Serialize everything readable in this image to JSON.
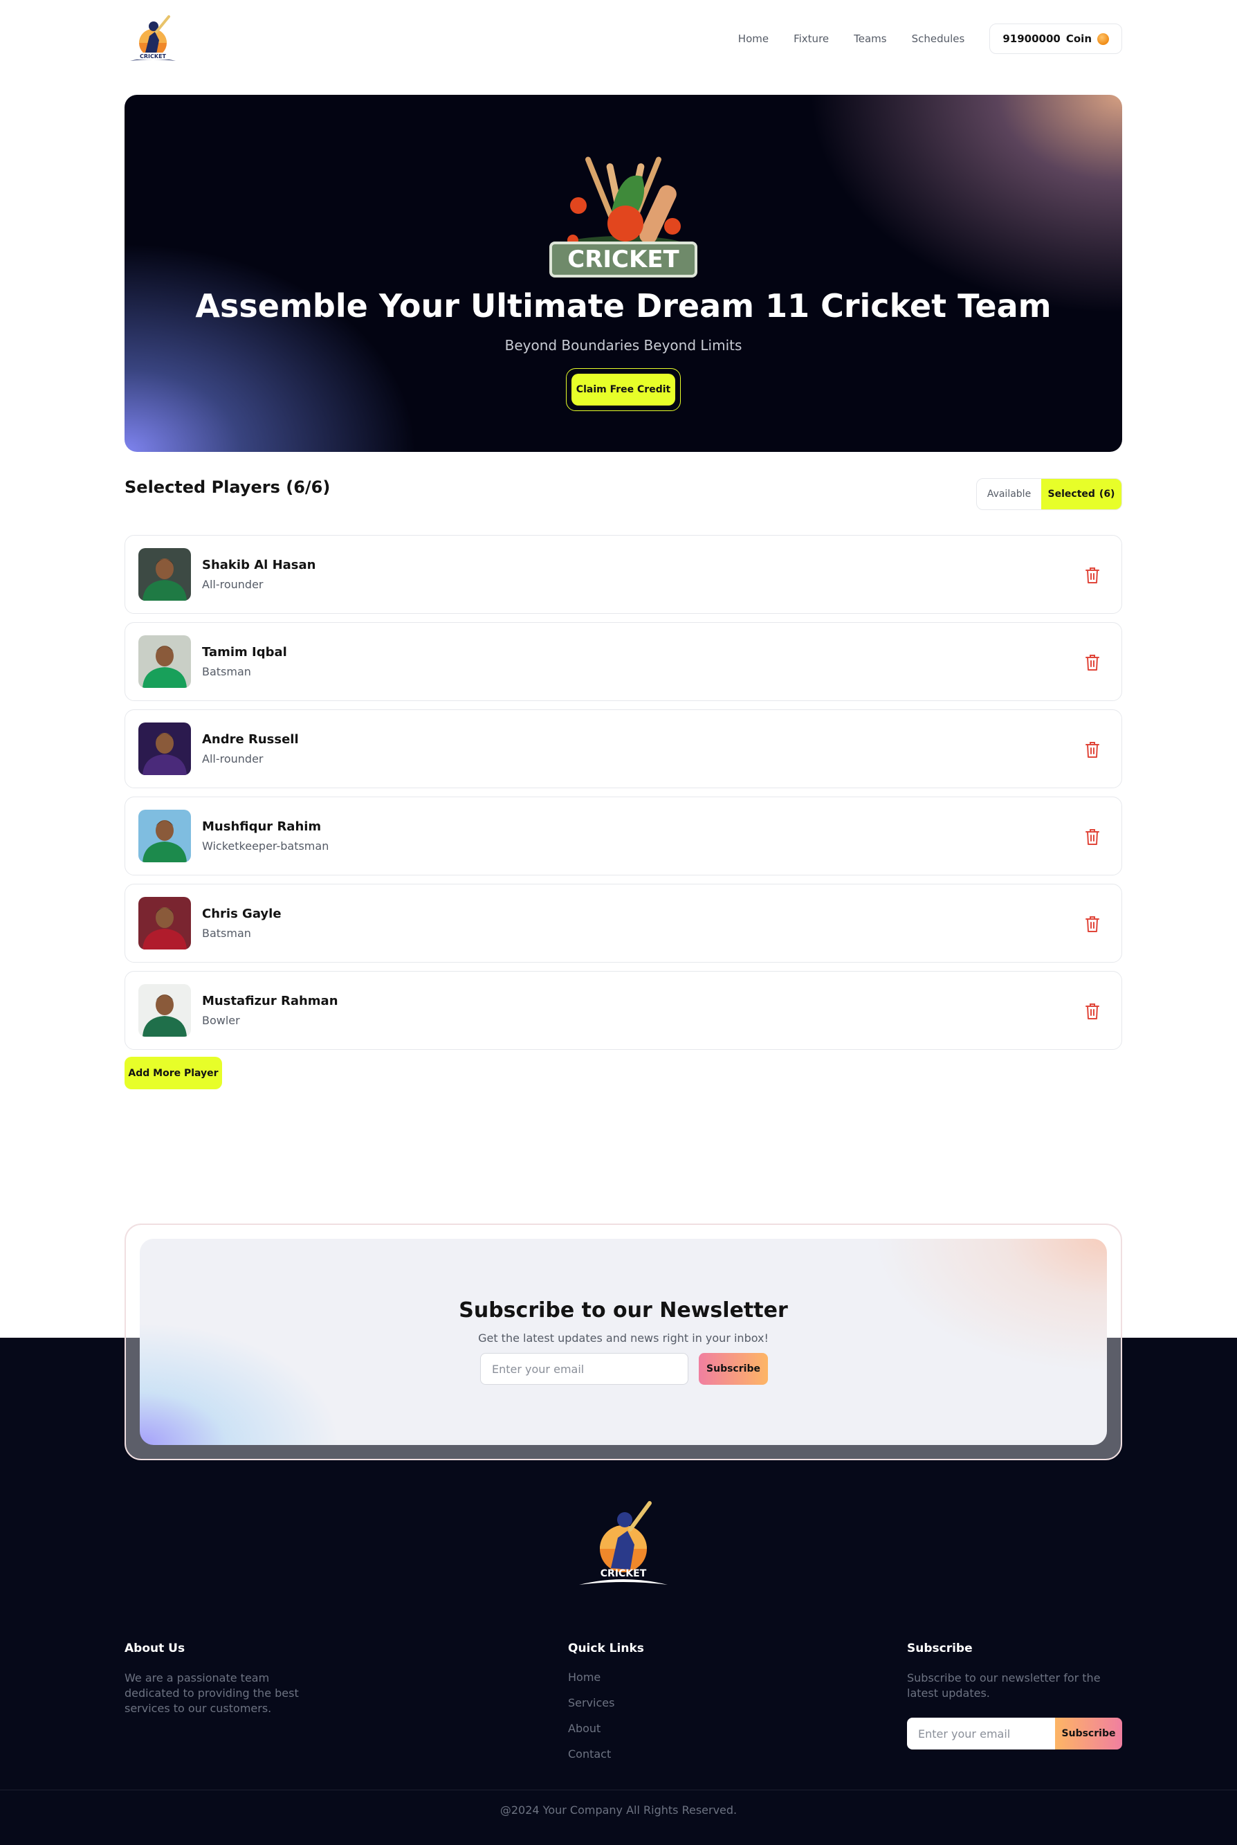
{
  "nav": {
    "links": [
      "Home",
      "Fixture",
      "Teams",
      "Schedules"
    ],
    "coin_amount": "91900000",
    "coin_label": "Coin",
    "logo_text": "CRICKET"
  },
  "hero": {
    "logo_text": "CRICKET",
    "title": "Assemble Your Ultimate Dream 11 Cricket Team",
    "subtitle": "Beyond Boundaries Beyond Limits",
    "cta": "Claim Free Credit"
  },
  "selected": {
    "title": "Selected Players (6/6)",
    "toggle_available": "Available",
    "toggle_selected": "Selected",
    "toggle_selected_count": "(6)",
    "players": [
      {
        "name": "Shakib Al Hasan",
        "role": "All-rounder",
        "jersey": "#1f7a44",
        "bg": "#3d4a44"
      },
      {
        "name": "Tamim Iqbal",
        "role": "Batsman",
        "jersey": "#18a05a",
        "bg": "#c9cfc6"
      },
      {
        "name": "Andre Russell",
        "role": "All-rounder",
        "jersey": "#4a2a7a",
        "bg": "#2b1a4e"
      },
      {
        "name": "Mushfiqur Rahim",
        "role": "Wicketkeeper-batsman",
        "jersey": "#1c8a4c",
        "bg": "#7fbde0"
      },
      {
        "name": "Chris Gayle",
        "role": "Batsman",
        "jersey": "#b01c2c",
        "bg": "#7a2530"
      },
      {
        "name": "Mustafizur Rahman",
        "role": "Bowler",
        "jersey": "#1f6f4a",
        "bg": "#eef0ee"
      }
    ],
    "add_button": "Add More Player"
  },
  "newsletter": {
    "title": "Subscribe to our Newsletter",
    "subtitle": "Get the latest updates and news right in your inbox!",
    "placeholder": "Enter your email",
    "button": "Subscribe"
  },
  "footer": {
    "logo_text": "CRICKET",
    "about_title": "About Us",
    "about_text": "We are a passionate team dedicated to providing the best services to our customers.",
    "links_title": "Quick Links",
    "links": [
      "Home",
      "Services",
      "About",
      "Contact"
    ],
    "subscribe_title": "Subscribe",
    "subscribe_text": "Subscribe to our newsletter for the latest updates.",
    "subscribe_placeholder": "Enter your email",
    "subscribe_button": "Subscribe",
    "copyright": "@2024 Your Company All Rights Reserved."
  },
  "colors": {
    "accent": "#e7fe29",
    "danger": "#e0463a",
    "footer_bg": "#060919",
    "hero_bg": "#030412"
  }
}
